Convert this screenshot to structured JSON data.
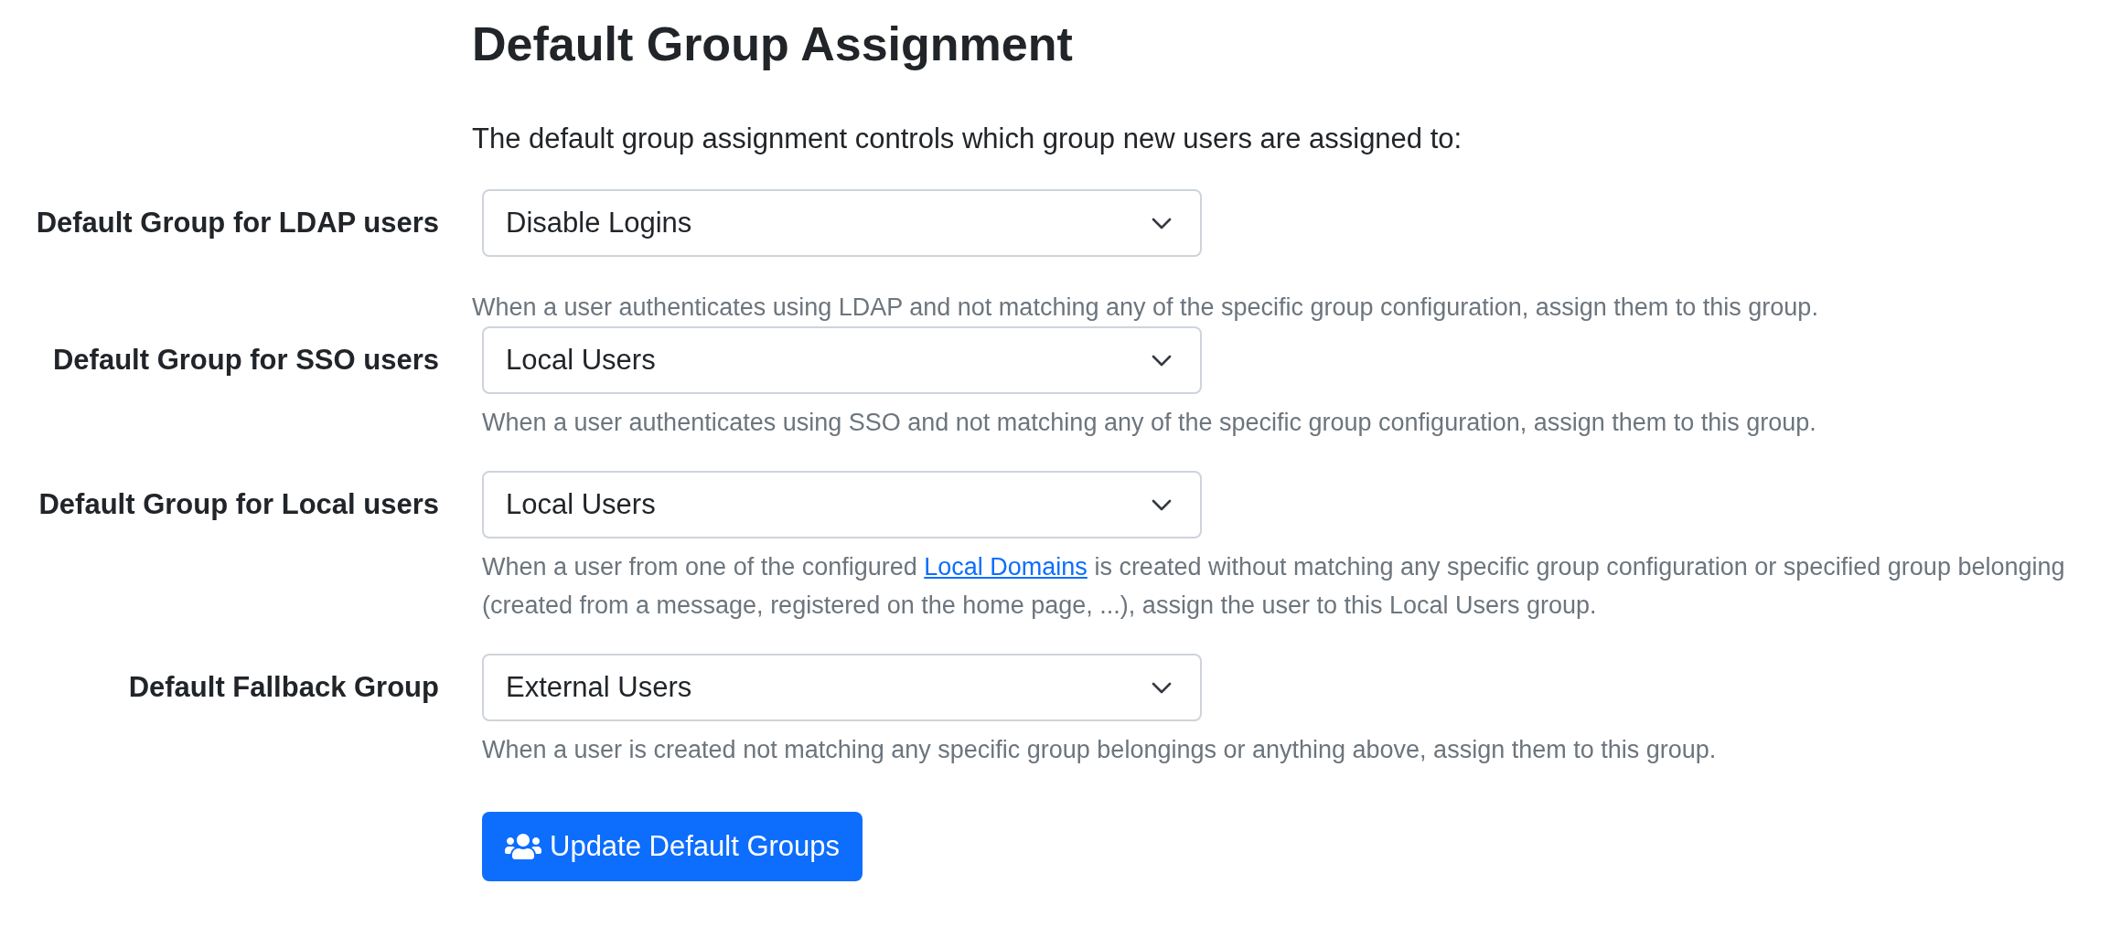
{
  "header": {
    "title": "Default Group Assignment",
    "intro": "The default group assignment controls which group new users are assigned to:"
  },
  "fields": [
    {
      "label": "Default Group for LDAP users",
      "value": "Disable Logins",
      "help": [
        {
          "kind": "text",
          "text": "When a user authenticates using LDAP and not matching any of the specific group configuration, assign them to this group."
        }
      ]
    },
    {
      "label": "Default Group for SSO users",
      "value": "Local Users",
      "help": [
        {
          "kind": "text",
          "text": "When a user authenticates using SSO and not matching any of the specific group configuration, assign them to this group."
        }
      ]
    },
    {
      "label": "Default Group for Local users",
      "value": "Local Users",
      "help": [
        {
          "kind": "text",
          "text": "When a user from one of the configured "
        },
        {
          "kind": "link",
          "text": "Local Domains"
        },
        {
          "kind": "text",
          "text": " is created without matching any specific group configuration or specified group belonging (created from a message, registered on the home page, ...), assign the user to this Local Users group."
        }
      ]
    },
    {
      "label": "Default Fallback Group",
      "value": "External Users",
      "help": [
        {
          "kind": "text",
          "text": "When a user is created not matching any specific group belongings or anything above, assign them to this group."
        }
      ]
    }
  ],
  "submit_button": {
    "label": "Update Default Groups"
  }
}
